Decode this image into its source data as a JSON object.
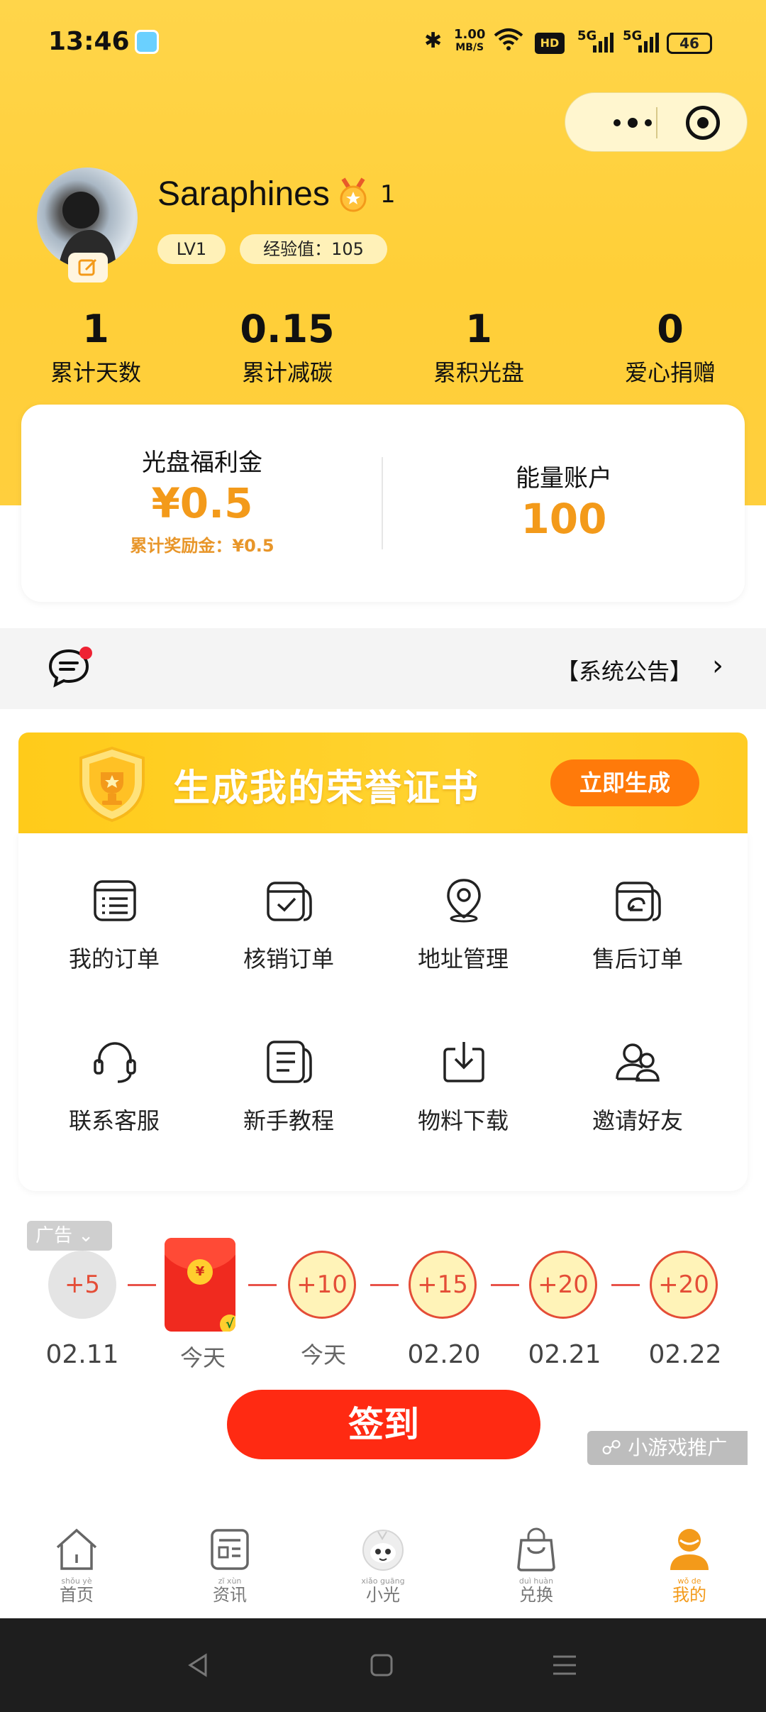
{
  "status_bar": {
    "time": "13:46",
    "speed_value": "1.00",
    "speed_unit": "MB/S",
    "hd_label": "HD",
    "net1": "5G",
    "net2": "5G",
    "battery": "46"
  },
  "profile": {
    "username": "Saraphines",
    "medal_count": "1",
    "level": "LV1",
    "exp": "经验值：105"
  },
  "stats": [
    {
      "value": "1",
      "label": "累计天数"
    },
    {
      "value": "0.15",
      "label": "累计减碳"
    },
    {
      "value": "1",
      "label": "累积光盘"
    },
    {
      "value": "0",
      "label": "爱心捐赠"
    }
  ],
  "wallet": {
    "welfare_title": "光盘福利金",
    "welfare_amount": "¥0.5",
    "welfare_total": "累计奖励金：¥0.5",
    "energy_title": "能量账户",
    "energy_amount": "100"
  },
  "notice": {
    "text": "【系统公告】"
  },
  "honor": {
    "title": "生成我的荣誉证书",
    "button": "立即生成"
  },
  "menu": {
    "items": [
      {
        "label": "我的订单",
        "icon": "order-list-icon"
      },
      {
        "label": "核销订单",
        "icon": "verify-order-icon"
      },
      {
        "label": "地址管理",
        "icon": "location-pin-icon"
      },
      {
        "label": "售后订单",
        "icon": "after-sales-icon"
      },
      {
        "label": "联系客服",
        "icon": "headset-icon"
      },
      {
        "label": "新手教程",
        "icon": "tutorial-doc-icon"
      },
      {
        "label": "物料下载",
        "icon": "download-icon"
      },
      {
        "label": "邀请好友",
        "icon": "invite-friends-icon"
      }
    ]
  },
  "signin": {
    "ad_tag": "广告",
    "days": [
      {
        "reward": "+5",
        "date": "02.11"
      },
      {
        "reward": "",
        "date": "今天"
      },
      {
        "reward": "+10",
        "date": "今天"
      },
      {
        "reward": "+15",
        "date": "02.20"
      },
      {
        "reward": "+20",
        "date": "02.21"
      },
      {
        "reward": "+20",
        "date": "02.22"
      }
    ],
    "packet_symbol": "¥",
    "button": "签到",
    "minigame": "小游戏推广"
  },
  "tabbar": {
    "tabs": [
      {
        "pinyin": "shǒu yè",
        "label": "首页",
        "icon": "home-icon"
      },
      {
        "pinyin": "zī xùn",
        "label": "资讯",
        "icon": "news-icon"
      },
      {
        "pinyin": "xiǎo guāng",
        "label": "小光",
        "icon": "mascot-icon"
      },
      {
        "pinyin": "duì huàn",
        "label": "兑换",
        "icon": "shopping-bag-icon"
      },
      {
        "pinyin": "wǒ de",
        "label": "我的",
        "icon": "user-icon"
      }
    ],
    "active_color": "#f39a1a"
  },
  "colors": {
    "brand_yellow": "#ffd54a",
    "accent_orange": "#f39a1a",
    "sign_red": "#ff2a12"
  }
}
